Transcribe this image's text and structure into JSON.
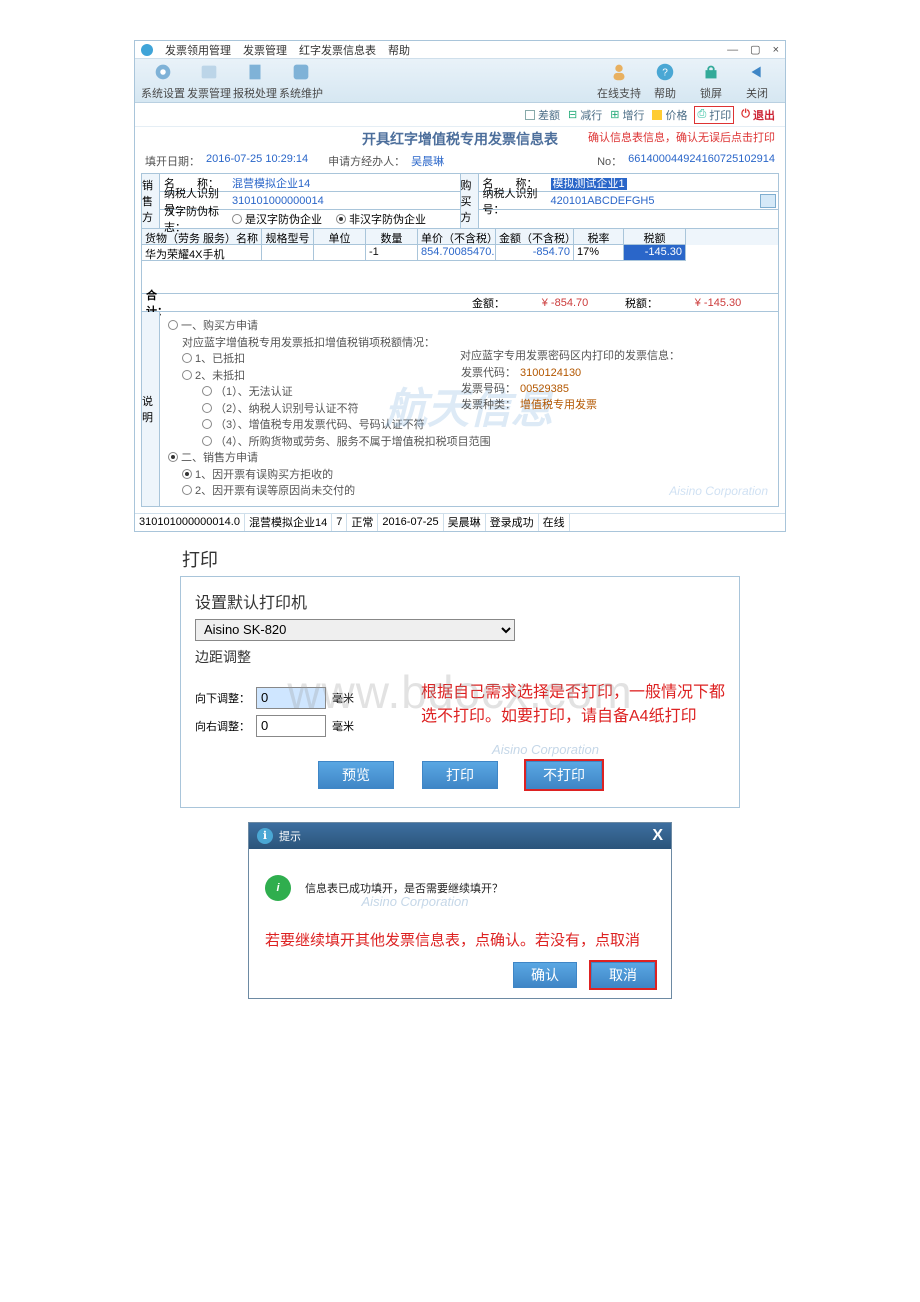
{
  "window1": {
    "titlebarMenus": [
      "发票领用管理",
      "发票管理",
      "红字发票信息表",
      "帮助"
    ],
    "ribbon": {
      "left": [
        "系统设置",
        "发票管理",
        "报税处理",
        "系统维护"
      ],
      "right": [
        "在线支持",
        "帮助",
        "锁屏",
        "关闭"
      ]
    },
    "toolbar2": {
      "chaE": "差额",
      "minusRow": "减行",
      "plusRow": "增行",
      "price": "价格",
      "print": "打印",
      "exit": "退出"
    },
    "doc": {
      "title": "开具红字增值税专用发票信息表",
      "confirmNote": "确认信息表信息，确认无误后点击打印",
      "fillDateLabel": "填开日期：",
      "fillDate": "2016-07-25 10:29:14",
      "applicantLabel": "申请方经办人：",
      "applicant": "吴晨琳",
      "noLabel": "No：",
      "no": "661400044924160725102914"
    },
    "seller": {
      "side": "销售方",
      "nameLabel": "名　　称：",
      "name": "混营模拟企业14",
      "taxIdLabel": "纳税人识别号：",
      "taxId": "310101000000014",
      "antiForgeryLabel": "汉字防伪标志：",
      "opt1": "是汉字防伪企业",
      "opt2": "非汉字防伪企业"
    },
    "buyer": {
      "side": "购买方",
      "nameLabel": "名　　称：",
      "name": "模拟测试企业1",
      "taxIdLabel": "纳税人识别号：",
      "taxId": "420101ABCDEFGH5"
    },
    "itemsHeader": [
      "货物（劳务 服务）名称",
      "规格型号",
      "单位",
      "数量",
      "单价（不含税）",
      "金额（不含税）",
      "税率",
      "税额"
    ],
    "item": {
      "name": "华为荣耀4X手机",
      "spec": "",
      "unit": "",
      "qty": "-1",
      "price": "854.70085470...",
      "amount": "-854.70",
      "rate": "17%",
      "tax": "-145.30"
    },
    "totals": {
      "label": "合 计：",
      "amountLabel": "金额：",
      "amount": "¥ -854.70",
      "taxLabel": "税额：",
      "tax": "¥ -145.30"
    },
    "explain": {
      "side": "说明",
      "sec1": "一、购买方申请",
      "line1": "对应蓝字增值税专用发票抵扣增值税销项税额情况：",
      "r1": "1、已抵扣",
      "r2": "2、未抵扣",
      "r2a": "（1）、无法认证",
      "r2b": "（2）、纳税人识别号认证不符",
      "r2c": "（3）、增值税专用发票代码、号码认证不符",
      "r2d": "（4）、所购货物或劳务、服务不属于增值税扣税项目范围",
      "sec2": "二、销售方申请",
      "s2a": "1、因开票有误购买方拒收的",
      "s2b": "2、因开票有误等原因尚未交付的",
      "rightTitle": "对应蓝字专用发票密码区内打印的发票信息：",
      "codeLabel": "发票代码：",
      "code": "3100124130",
      "numLabel": "发票号码：",
      "num": "00529385",
      "typeLabel": "发票种类：",
      "type": "增值税专用发票"
    },
    "statusbar": [
      "310101000000014.0",
      "混营模拟企业14",
      "7",
      "正常",
      "2016-07-25",
      "吴晨琳",
      "登录成功",
      "在线"
    ],
    "watermark": "航天信息",
    "watermark2": "Aisino Corporation"
  },
  "window2": {
    "heading": "打印",
    "setDefault": "设置默认打印机",
    "printerSelected": "Aisino SK-820",
    "marginTitle": "边距调整",
    "downLabel": "向下调整：",
    "downVal": "0",
    "unit": "毫米",
    "rightLabel": "向右调整：",
    "rightVal": "0",
    "note": "根据自己需求选择是否打印，一般情况下都选不打印。如要打印，请自备A4纸打印",
    "preview": "预览",
    "print": "打印",
    "noPrint": "不打印",
    "wmBig": "www.bdocx.com",
    "wmSmall": "Aisino Corporation"
  },
  "window3": {
    "title": "提示",
    "msg": "信息表已成功填开，是否需要继续填开？",
    "note": "若要继续填开其他发票信息表，点确认。若没有，点取消",
    "ok": "确认",
    "cancel": "取消",
    "wm": "Aisino Corporation"
  }
}
